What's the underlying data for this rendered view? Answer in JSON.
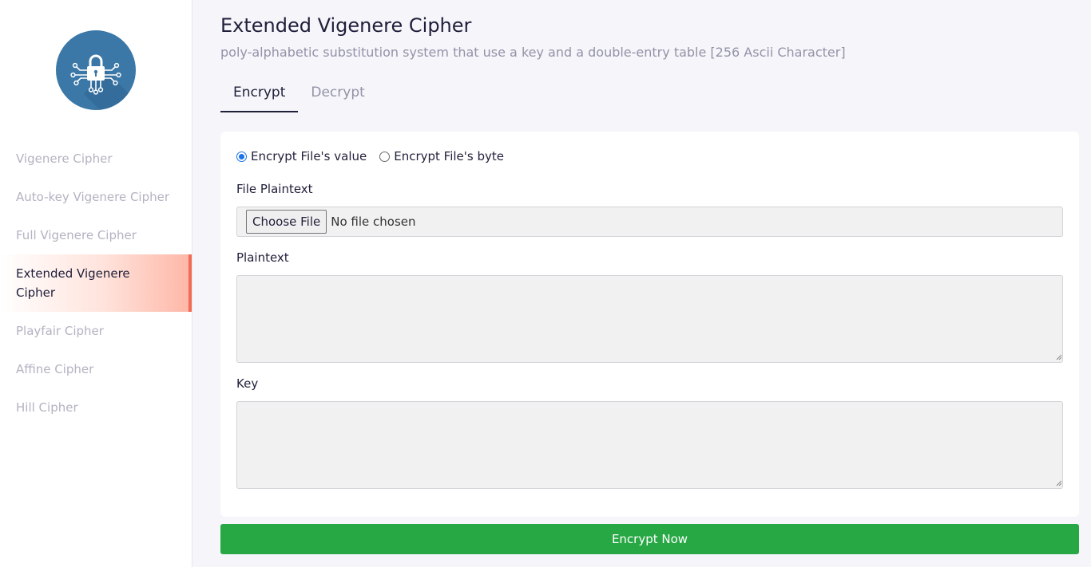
{
  "sidebar": {
    "logo_icon": "circuit-lock-icon",
    "items": [
      {
        "label": "Vigenere Cipher"
      },
      {
        "label": "Auto-key Vigenere Cipher"
      },
      {
        "label": "Full Vigenere Cipher"
      },
      {
        "label": "Extended Vigenere Cipher",
        "active": true
      },
      {
        "label": "Playfair Cipher"
      },
      {
        "label": "Affine Cipher"
      },
      {
        "label": "Hill Cipher"
      }
    ]
  },
  "header": {
    "title": "Extended Vigenere Cipher",
    "subtitle": "poly-alphabetic substitution system that use a key and a double-entry table [256 Ascii Character]"
  },
  "tabs": [
    {
      "label": "Encrypt",
      "active": true
    },
    {
      "label": "Decrypt",
      "active": false
    }
  ],
  "form": {
    "mode_options": [
      {
        "label": "Encrypt File's value",
        "checked": true
      },
      {
        "label": "Encrypt File's byte",
        "checked": false
      }
    ],
    "file_label": "File Plaintext",
    "file_button": "Choose File",
    "file_status": "No file chosen",
    "plaintext_label": "Plaintext",
    "plaintext_value": "",
    "key_label": "Key",
    "key_value": ""
  },
  "submit_label": "Encrypt Now",
  "colors": {
    "accent": "#f26c54",
    "logo_bg": "#3b78a8",
    "submit": "#28a745",
    "radio_checked": "#1a73e8"
  }
}
